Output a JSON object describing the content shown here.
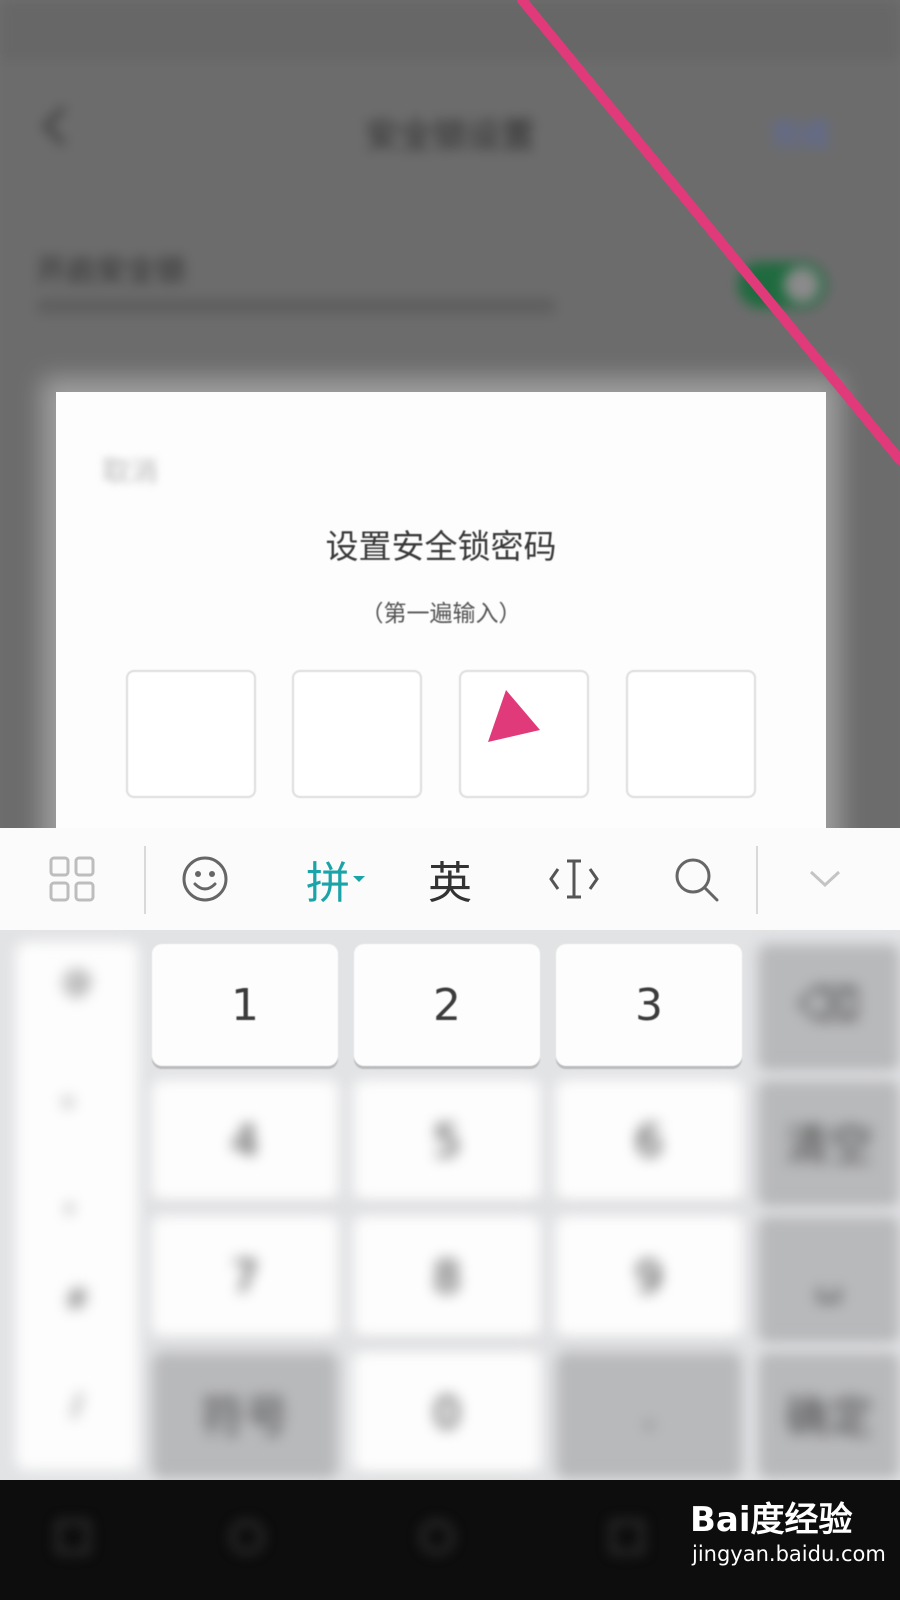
{
  "background_page": {
    "title": "安全锁设置",
    "action_label": "完成",
    "row_label": "开启安全锁",
    "switch_on": true
  },
  "dialog": {
    "cancel_label": "取消",
    "title": "设置安全锁密码",
    "subtitle": "（第一遍输入）",
    "pin_length": 4
  },
  "keyboard": {
    "toolbar": {
      "items": [
        {
          "name": "grid-icon"
        },
        {
          "name": "emoji-icon"
        },
        {
          "name": "pinyin-mode",
          "label": "拼",
          "active": true
        },
        {
          "name": "english-mode",
          "label": "英"
        },
        {
          "name": "cursor-icon"
        },
        {
          "name": "search-icon"
        },
        {
          "name": "collapse-icon"
        }
      ]
    },
    "side_symbols": [
      "@",
      "。",
      "，",
      "#",
      "/"
    ],
    "keys": {
      "k1": "1",
      "k2": "2",
      "k3": "3",
      "k4": "4",
      "k5": "5",
      "k6": "6",
      "k7": "7",
      "k8": "8",
      "k9": "9",
      "k0": "0",
      "symbols": "符号",
      "dot": ".",
      "del": "⌫",
      "clear": "清空",
      "space": "␣",
      "enter": "确定"
    },
    "accent_color": "#1aa3a8"
  },
  "annotation": {
    "arrow_color": "#e03a7a"
  },
  "watermark": {
    "logo": "Bai度经验",
    "url": "jingyan.baidu.com"
  }
}
